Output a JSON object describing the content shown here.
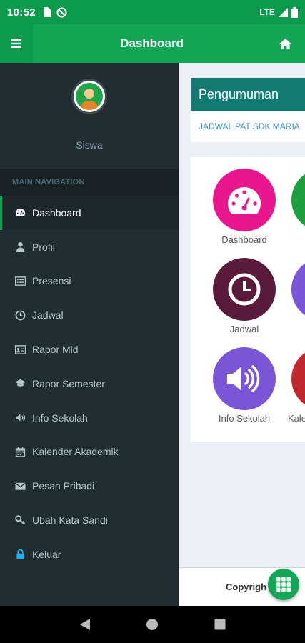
{
  "status_bar": {
    "time": "10:52",
    "network": "LTE",
    "icons": [
      "sim-card-icon",
      "do-not-disturb-icon",
      "signal-icon",
      "battery-icon"
    ]
  },
  "header": {
    "title": "Dashboard",
    "menu_icon": "hamburger-menu-icon",
    "home_icon": "home-icon",
    "color": "#13a655"
  },
  "sidebar": {
    "user_name": "Siswa",
    "nav_header": "MAIN NAVIGATION",
    "items": [
      {
        "label": "Dashboard",
        "icon": "dashboard-icon",
        "active": true
      },
      {
        "label": "Profil",
        "icon": "user-icon"
      },
      {
        "label": "Presensi",
        "icon": "list-card-icon"
      },
      {
        "label": "Jadwal",
        "icon": "clock-icon"
      },
      {
        "label": "Rapor Mid",
        "icon": "id-card-icon"
      },
      {
        "label": "Rapor Semester",
        "icon": "graduation-cap-icon"
      },
      {
        "label": "Info Sekolah",
        "icon": "speaker-icon"
      },
      {
        "label": "Kalender Akademik",
        "icon": "calendar-icon"
      },
      {
        "label": "Pesan Pribadi",
        "icon": "envelope-icon"
      },
      {
        "label": "Ubah Kata Sandi",
        "icon": "key-icon"
      },
      {
        "label": "Keluar",
        "icon": "lock-icon"
      }
    ],
    "background": "#222d32"
  },
  "main": {
    "announcement": {
      "title": "Pengumuman",
      "text": "JADWAL PAT SDK MARIA"
    },
    "tiles": [
      {
        "label": "Dashboard",
        "icon": "dashboard-gauge-icon",
        "color": "#e8168f"
      },
      {
        "label": "Jadwal",
        "icon": "clock-icon",
        "color": "#5a1a3a"
      },
      {
        "label": "Info Sekolah",
        "icon": "speaker-icon",
        "color": "#7a55d6"
      },
      {
        "label": "Kale",
        "icon": "calendar-icon",
        "color": "#c0282e"
      }
    ],
    "footer": {
      "text": "Copyrigh"
    }
  },
  "fab": {
    "icon": "grid-apps-icon"
  },
  "system_nav": {
    "icons": [
      "back-icon",
      "home-circle-icon",
      "recents-icon"
    ]
  }
}
